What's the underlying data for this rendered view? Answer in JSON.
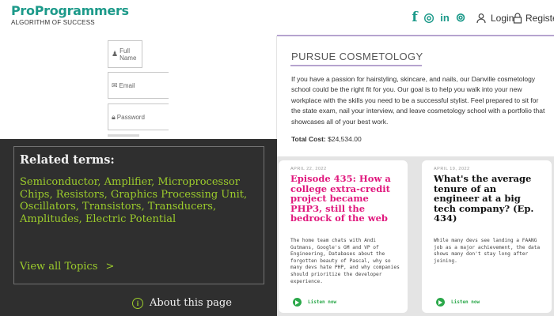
{
  "header": {
    "logo_title": "ProProgrammers",
    "logo_subtitle": "ALGORITHM OF SUCCESS",
    "social": [
      {
        "name": "facebook-icon",
        "glyph": "f"
      },
      {
        "name": "instagram-icon",
        "glyph": "◎"
      },
      {
        "name": "linkedin-icon",
        "glyph": "in"
      },
      {
        "name": "badge-icon",
        "glyph": "⊚"
      }
    ],
    "login_label": "Login",
    "register_label": "Register",
    "accent_color": "#1d9a8a"
  },
  "signup_form": {
    "full_name_placeholder": "Full Name",
    "email_placeholder": "Email",
    "password_placeholder": "Password"
  },
  "related_terms": {
    "heading": "Related terms:",
    "terms": "Semiconductor, Amplifier, Microprocessor Chips, Resistors, Graphics Processing Unit, Oscillators, Transistors, Transducers, Amplitudes, Electric Potential",
    "view_all": "View all Topics",
    "text_color": "#9ccc2c"
  },
  "about": {
    "label": "About this page"
  },
  "cosmetology": {
    "title": "PURSUE COSMETOLOGY",
    "body": "If you have a passion for hairstyling, skincare, and nails, our Danville cosmetology school could be the right fit for you. Our goal is to help you walk into your new workplace with the skills you need to be a successful stylist. Feel prepared to sit for the state exam, nail your interview, and leave cosmetology school with a portfolio that showcases all of your best work.",
    "cost_label": "Total Cost:",
    "cost_value": "$24,534.00"
  },
  "podcasts": [
    {
      "date": "APRIL 22, 2022",
      "title": "Episode 435: How a college extra-credit project became PHP3, still the bedrock of the web",
      "title_color": "#e0187d",
      "description": "The home team chats with Andi Gutmans, Google's GM and VP of Engineering, Databases about the forgotten beauty of Pascal, why so many devs hate PHP, and why companies should prioritize the developer experience.",
      "listen": "Listen now"
    },
    {
      "date": "APRIL 19, 2022",
      "title": "What's the average tenure of an engineer at a big tech company? (Ep. 434)",
      "title_color": "#111111",
      "description": "While many devs see landing a FAANG job as a major achievement, the data shows many don't stay long after joining.",
      "listen": "Listen now"
    }
  ]
}
